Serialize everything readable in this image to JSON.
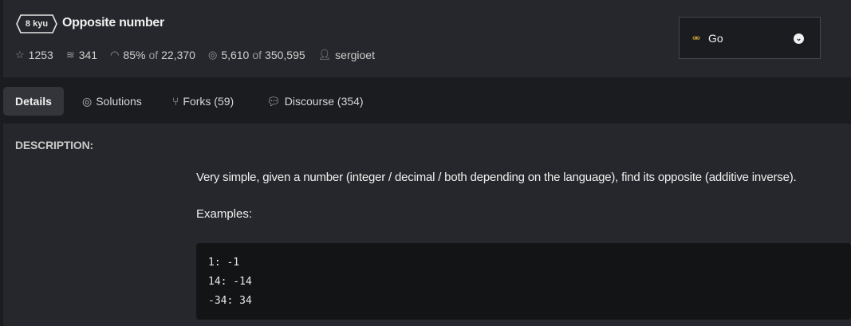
{
  "kata": {
    "rank": "8 kyu",
    "title": "Opposite number"
  },
  "stats": {
    "stars": "1253",
    "collections": "341",
    "satisfaction": "85%",
    "satisfaction_of": "of",
    "votes": "22,370",
    "completed": "5,610",
    "completed_of": "of",
    "attempts": "350,595",
    "author": "sergioet"
  },
  "language_select": {
    "selected": "Go",
    "icon": "go-gopher-icon"
  },
  "tabs": [
    {
      "label": "Details",
      "active": true,
      "icon": ""
    },
    {
      "label": "Solutions",
      "active": false,
      "icon": "target-icon"
    },
    {
      "label": "Forks (59)",
      "active": false,
      "icon": "fork-icon"
    },
    {
      "label": "Discourse (354)",
      "active": false,
      "icon": "chat-icon"
    }
  ],
  "description": {
    "heading": "DESCRIPTION:",
    "text": "Very simple, given a number (integer / decimal / both depending on the language), find its opposite (additive inverse).",
    "examples_label": "Examples:",
    "code_lines": [
      "1: -1",
      "14: -14",
      "-34: 34"
    ]
  },
  "colors": {
    "page_bg": "#1b1c20",
    "panel_bg": "#26272c",
    "code_bg": "#131416",
    "accent_go": "#d9a93e"
  }
}
